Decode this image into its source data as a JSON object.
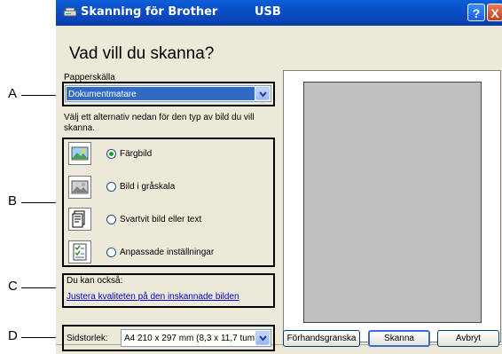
{
  "window": {
    "title": "Skanning för Brother",
    "connection": "USB",
    "help_label": "?",
    "close_label": "X"
  },
  "main": {
    "heading": "Vad vill du skanna?",
    "paper_source_label": "Papperskälla",
    "paper_source_value": "Dokumentmatare",
    "options_intro": "Välj ett alternativ nedan för den typ av bild du vill skanna.",
    "options": [
      {
        "label": "Färgbild",
        "selected": true,
        "icon": "color-photo-icon"
      },
      {
        "label": "Bild i gråskala",
        "selected": false,
        "icon": "grayscale-photo-icon"
      },
      {
        "label": "Svartvit bild eller text",
        "selected": false,
        "icon": "bw-text-icon"
      },
      {
        "label": "Anpassade inställningar",
        "selected": false,
        "icon": "custom-settings-icon"
      }
    ],
    "also_label": "Du kan också:",
    "quality_link": "Justera kvaliteten på den inskannade bilden",
    "page_size_label": "Sidstorlek:",
    "page_size_value": "A4 210 x 297 mm (8,3 x 11,7 tum"
  },
  "buttons": {
    "preview": "Förhandsgranska",
    "scan": "Skanna",
    "cancel": "Avbryt"
  },
  "callouts": [
    "A",
    "B",
    "C",
    "D"
  ]
}
